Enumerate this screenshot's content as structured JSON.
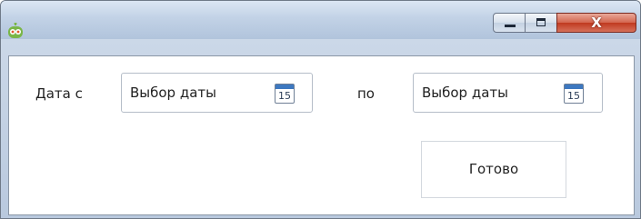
{
  "window": {
    "app_icon": "robot-app-icon",
    "controls": {
      "minimize_icon": "minimize-icon",
      "maximize_icon": "maximize-icon",
      "close_icon": "close-icon",
      "close_glyph": "X"
    }
  },
  "form": {
    "date_from_label": "Дата с",
    "date_from_placeholder": "Выбор даты",
    "date_to_label": "по",
    "date_to_placeholder": "Выбор даты",
    "calendar_icon": "calendar-icon",
    "calendar_day": "15",
    "done_label": "Готово"
  }
}
